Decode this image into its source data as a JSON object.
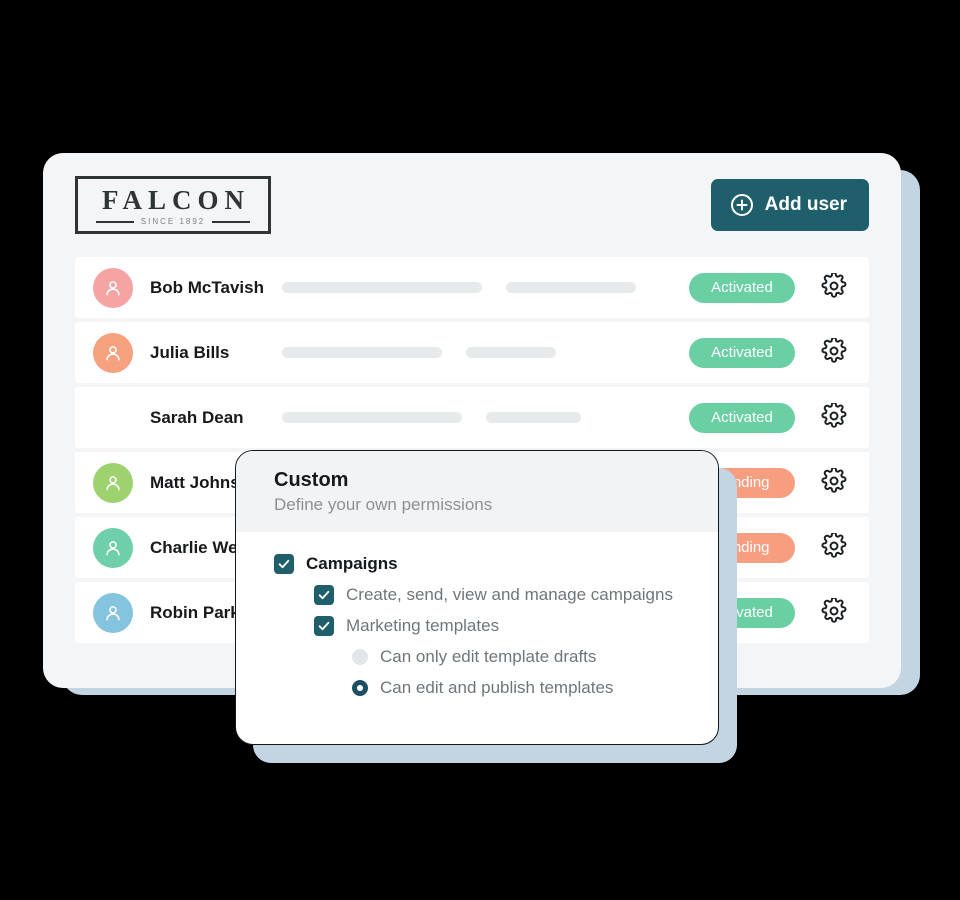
{
  "app": {
    "logo": {
      "name": "FALCON",
      "tagline": "SINCE 1892"
    },
    "add_user_button": "Add user",
    "add_user_icon": "plus-circle-icon"
  },
  "colors": {
    "page_background": "#000000",
    "card_background": "#f4f5f6",
    "shadow_plate": "#c3d5e3",
    "accent_teal": "#1f5f6b",
    "badge_activated": "#6ad0a4",
    "badge_pending": "#f79e80",
    "skeleton": "#e7eaea"
  },
  "users": [
    {
      "name": "Bob McTavish",
      "status": "Activated",
      "status_type": "activated",
      "avatar_color": "#f6a3a3",
      "skeleton_widths": [
        200,
        130
      ]
    },
    {
      "name": "Julia Bills",
      "status": "Activated",
      "status_type": "activated",
      "avatar_color": "#f6a27f",
      "skeleton_widths": [
        160,
        90
      ]
    },
    {
      "name": "Sarah Dean",
      "status": "Activated",
      "status_type": "activated",
      "avatar_color": "#e8b košt44",
      "skeleton_widths": [
        180,
        95
      ]
    },
    {
      "name": "Matt Johnson",
      "status": "Pending",
      "status_type": "pending",
      "avatar_color": "#9ed26f",
      "skeleton_widths": [
        170,
        110
      ]
    },
    {
      "name": "Charlie Wells",
      "status": "Pending",
      "status_type": "pending",
      "avatar_color": "#6ecfa8",
      "skeleton_widths": [
        190,
        120
      ]
    },
    {
      "name": "Robin Parker",
      "status": "Activated",
      "status_type": "activated",
      "avatar_color": "#85c4de",
      "skeleton_widths": [
        150,
        100
      ]
    }
  ],
  "modal": {
    "title": "Custom",
    "subtitle": "Define your own permissions",
    "permissions": [
      {
        "control": "checkbox",
        "checked": true,
        "indent": 0,
        "label": "Campaigns",
        "bold": true
      },
      {
        "control": "checkbox",
        "checked": true,
        "indent": 1,
        "label": "Create, send, view and manage campaigns",
        "bold": false
      },
      {
        "control": "checkbox",
        "checked": true,
        "indent": 1,
        "label": "Marketing templates",
        "bold": false
      },
      {
        "control": "radio",
        "selected": false,
        "indent": 2,
        "label": "Can only edit template drafts",
        "bold": false
      },
      {
        "control": "radio",
        "selected": true,
        "indent": 2,
        "label": "Can edit and publish templates",
        "bold": false
      }
    ]
  },
  "icons": {
    "gear": "gear-icon",
    "avatar_person": "person-icon",
    "check": "check-icon"
  }
}
